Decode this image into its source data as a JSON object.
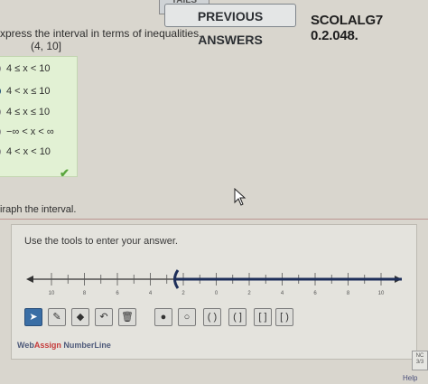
{
  "header": {
    "tab_text": "TAILS",
    "previous_answers_label": "PREVIOUS ANSWERS",
    "problem_code": "SCOLALG7 0.2.048."
  },
  "question": {
    "prompt": "xpress the interval in terms of inequalities.",
    "interval": "(4, 10]",
    "choices": [
      {
        "label": "4 ≤ x < 10",
        "selected": false
      },
      {
        "label": "4 < x ≤ 10",
        "selected": true
      },
      {
        "label": "4 ≤ x ≤ 10",
        "selected": false
      },
      {
        "label": "−∞ < x < ∞",
        "selected": false
      },
      {
        "label": "4 < x < 10",
        "selected": false
      }
    ],
    "correct_mark": "✔"
  },
  "graph": {
    "prompt": "iraph the interval.",
    "instructions": "Use the tools to enter your answer.",
    "tick_labels": [
      "10",
      "8",
      "6",
      "4",
      "2",
      "0",
      "2",
      "4",
      "6",
      "8",
      "10"
    ],
    "tools": [
      {
        "name": "pointer-tool",
        "glyph": "➤"
      },
      {
        "name": "pencil-tool",
        "glyph": "✎"
      },
      {
        "name": "fill-tool",
        "glyph": "◆"
      },
      {
        "name": "undo-tool",
        "glyph": "↶"
      },
      {
        "name": "delete-tool",
        "glyph": "🗑"
      },
      {
        "name": "closed-point-tool",
        "glyph": "●"
      },
      {
        "name": "open-point-tool",
        "glyph": "○"
      },
      {
        "name": "open-open-interval-tool",
        "glyph": "( )"
      },
      {
        "name": "open-closed-interval-tool",
        "glyph": "( ]"
      },
      {
        "name": "closed-closed-interval-tool",
        "glyph": "[ ]"
      },
      {
        "name": "closed-open-interval-tool",
        "glyph": "[ )"
      }
    ],
    "brand_web": "Web",
    "brand_assign": "Assign",
    "brand_product": " NumberLine"
  },
  "footer": {
    "badge_text": "NC\n3/3",
    "help_text": "Help"
  }
}
